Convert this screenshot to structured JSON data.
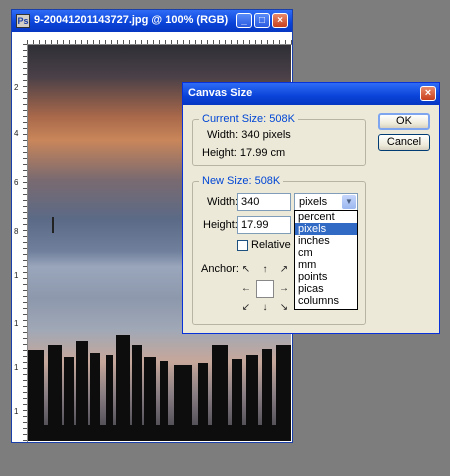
{
  "document_window": {
    "title": "9-20041201143727.jpg @ 100% (RGB)",
    "buttons": {
      "minimize": "_",
      "maximize": "□",
      "close": "×"
    },
    "ruler_left_labels": [
      "2",
      "4",
      "6",
      "8",
      "1",
      "1",
      "1",
      "1"
    ]
  },
  "dialog": {
    "title": "Canvas Size",
    "close_label": "×",
    "current_size": {
      "legend": "Current Size: 508K",
      "width_line": "Width: 340 pixels",
      "height_line": "Height: 17.99 cm"
    },
    "new_size": {
      "legend": "New Size: 508K",
      "width_label": "Width:",
      "width_value": "340",
      "height_label": "Height:",
      "height_value": "17.99",
      "unit_selected": "pixels",
      "unit_options": [
        "percent",
        "pixels",
        "inches",
        "cm",
        "mm",
        "points",
        "picas",
        "columns"
      ],
      "relative_label": "Relative",
      "anchor_label": "Anchor:",
      "anchor_arrows": [
        "↖",
        "↑",
        "↗",
        "←",
        "",
        "→",
        "↙",
        "↓",
        "↘"
      ]
    },
    "ok_label": "OK",
    "cancel_label": "Cancel"
  },
  "colors": {
    "titlebar": "#0a43d8",
    "dialog_bg": "#ece9d8",
    "legend_text": "#0046d5",
    "selection": "#316ac5",
    "desktop": "#7d7d7d"
  }
}
